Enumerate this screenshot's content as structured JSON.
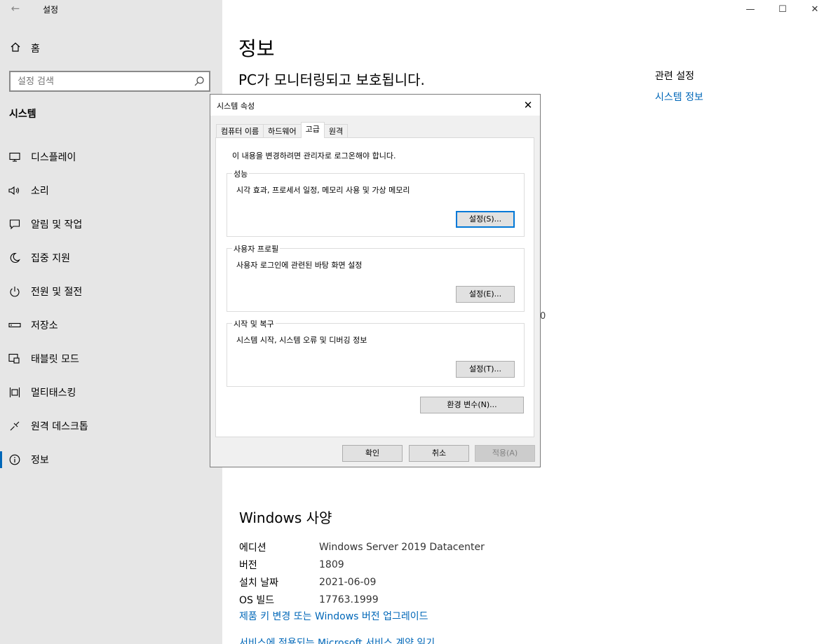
{
  "app": {
    "title": "설정",
    "back_glyph": "←"
  },
  "window_controls": {
    "minimize": "—",
    "maximize": "☐",
    "close": "✕"
  },
  "sidebar": {
    "home_label": "홈",
    "search_placeholder": "설정 검색",
    "section_title": "시스템",
    "items": [
      {
        "label": "디스플레이",
        "icon": "monitor-icon"
      },
      {
        "label": "소리",
        "icon": "speaker-icon"
      },
      {
        "label": "알림 및 작업",
        "icon": "notification-icon"
      },
      {
        "label": "집중 지원",
        "icon": "moon-icon"
      },
      {
        "label": "전원 및 절전",
        "icon": "power-icon"
      },
      {
        "label": "저장소",
        "icon": "storage-icon"
      },
      {
        "label": "태블릿 모드",
        "icon": "tablet-icon"
      },
      {
        "label": "멀티태스킹",
        "icon": "multitasking-icon"
      },
      {
        "label": "원격 데스크톱",
        "icon": "remote-desktop-icon"
      },
      {
        "label": "정보",
        "icon": "info-icon",
        "active": true
      }
    ]
  },
  "main": {
    "title": "정보",
    "subtitle": "PC가 모니터링되고 보호됩니다.",
    "stray_char": "0",
    "related": {
      "heading": "관련 설정",
      "link": "시스템 정보"
    },
    "windows_spec": {
      "title": "Windows 사양",
      "rows": [
        {
          "key": "에디션",
          "value": "Windows Server 2019 Datacenter"
        },
        {
          "key": "버전",
          "value": "1809"
        },
        {
          "key": "설치 날짜",
          "value": "2021-06-09"
        },
        {
          "key": "OS 빌드",
          "value": "17763.1999"
        }
      ],
      "link_upgrade": "제품 키 변경 또는 Windows 버전 업그레이드",
      "link_terms": "서비스에 적용되는 Microsoft 서비스 계약 읽기"
    }
  },
  "dialog": {
    "title": "시스템 속성",
    "close_glyph": "✕",
    "tabs": [
      "컴퓨터 이름",
      "하드웨어",
      "고급",
      "원격"
    ],
    "active_tab": 2,
    "notice": "이 내용을 변경하려면 관리자로 로그온해야 합니다.",
    "groups": [
      {
        "label": "성능",
        "desc": "시각 효과, 프로세서 일정, 메모리 사용 및 가상 메모리",
        "button": "설정(S)..."
      },
      {
        "label": "사용자 프로필",
        "desc": "사용자 로그인에 관련된 바탕 화면 설정",
        "button": "설정(E)..."
      },
      {
        "label": "시작 및 복구",
        "desc": "시스템 시작, 시스템 오류 및 디버깅 정보",
        "button": "설정(T)..."
      }
    ],
    "env_button": "환경 변수(N)...",
    "ok": "확인",
    "cancel": "취소",
    "apply": "적용(A)"
  }
}
